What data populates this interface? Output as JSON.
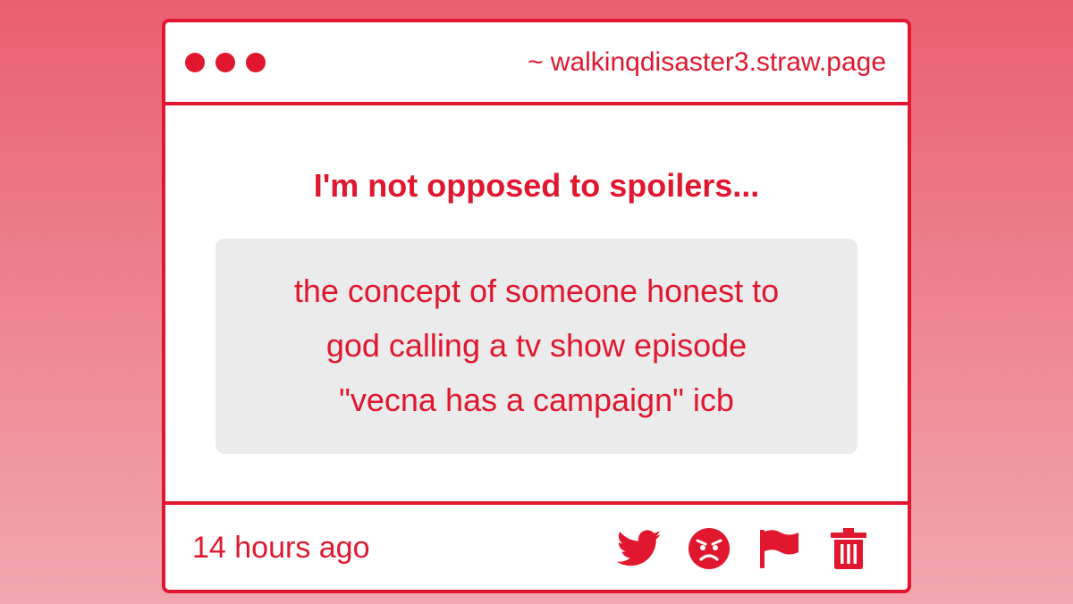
{
  "window": {
    "url": "~ walkinqdisaster3.straw.page"
  },
  "post": {
    "question": "I'm not opposed to spoilers...",
    "answer_lines": [
      "the concept of someone honest to",
      "god calling a tv show episode",
      "\"vecna has a campaign\" icb"
    ],
    "timestamp": "14 hours ago"
  },
  "actions": [
    {
      "name": "twitter-share-button",
      "icon": "twitter-bird-icon"
    },
    {
      "name": "react-button",
      "icon": "angry-face-icon"
    },
    {
      "name": "report-button",
      "icon": "flag-icon"
    },
    {
      "name": "delete-button",
      "icon": "trash-icon"
    }
  ],
  "colors": {
    "accent": "#e0172e",
    "answer_background": "#ebebeb",
    "page_gradient_top": "#e95f70",
    "page_gradient_bottom": "#f3a7b0"
  }
}
